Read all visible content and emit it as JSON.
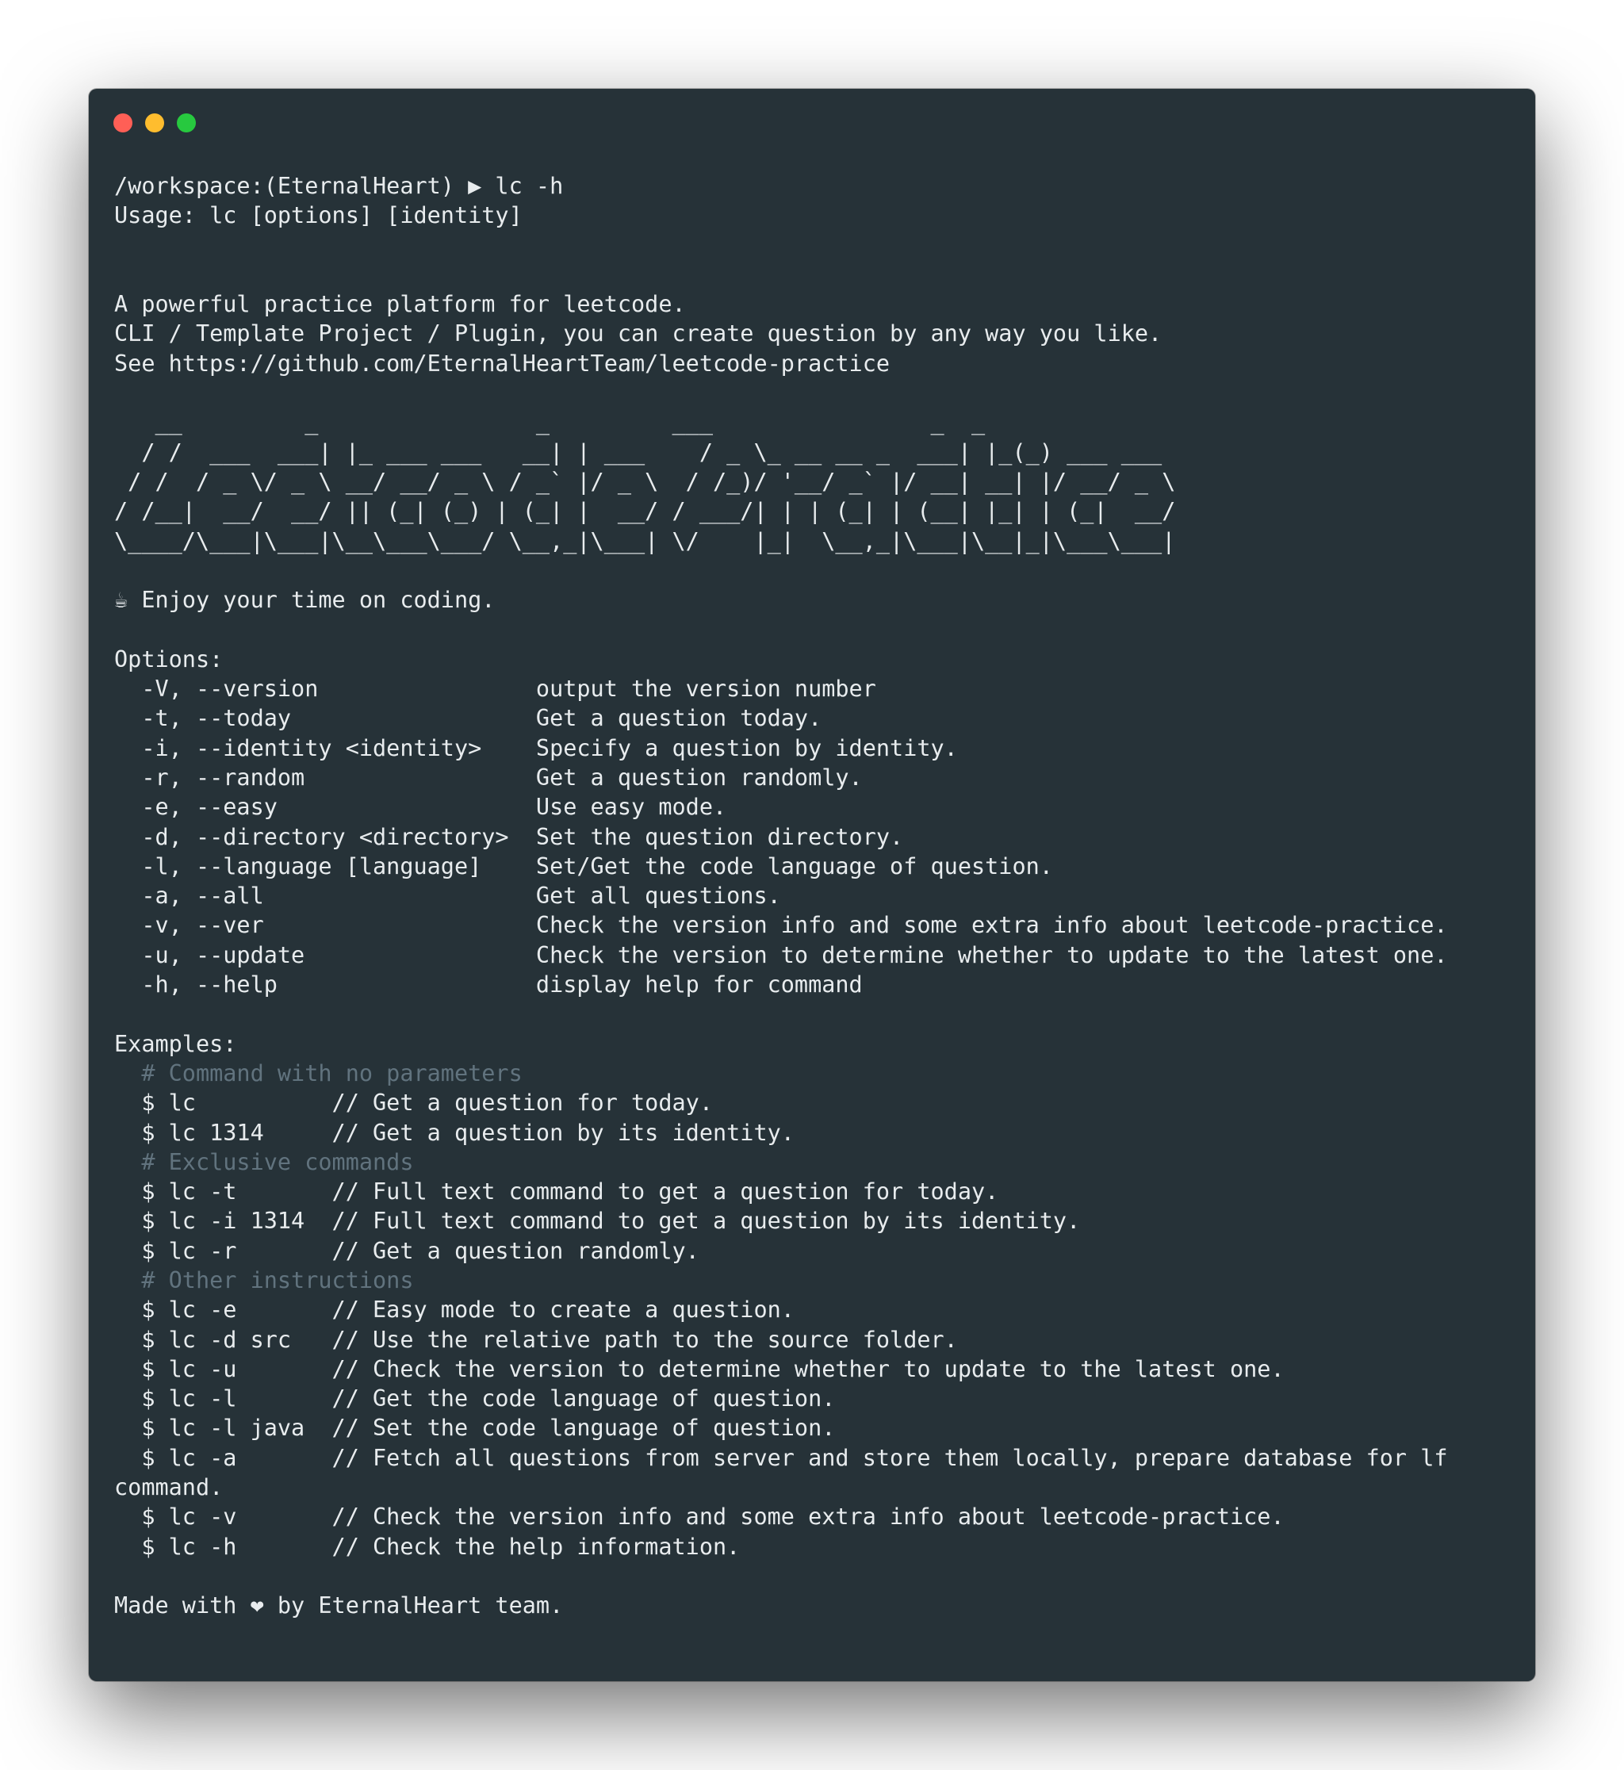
{
  "window": {
    "buttons": {
      "close_color": "#ff5f56",
      "minimize_color": "#ffbd2e",
      "maximize_color": "#27c93f"
    },
    "background_color": "#263238",
    "comment_color": "#61737e"
  },
  "terminal": {
    "lines": [
      {
        "text": "/workspace:(EternalHeart) ▶ lc -h",
        "kind": "prompt"
      },
      {
        "text": "Usage: lc [options] [identity]",
        "kind": "text"
      },
      {
        "text": "",
        "kind": "text"
      },
      {
        "text": "",
        "kind": "text"
      },
      {
        "text": "A powerful practice platform for leetcode.",
        "kind": "text"
      },
      {
        "text": "CLI / Template Project / Plugin, you can create question by any way you like.",
        "kind": "text"
      },
      {
        "text": "See https://github.com/EternalHeartTeam/leetcode-practice",
        "kind": "text"
      },
      {
        "text": "",
        "kind": "text"
      },
      {
        "text": "   __         _                _         ___                _  _",
        "kind": "text"
      },
      {
        "text": "  / /  ___  ___| |_ ___ ___   __| | ___    / _ \\_ __ __ _  ___| |_(_) ___ ___",
        "kind": "text"
      },
      {
        "text": " / /  / _ \\/ _ \\ __/ __/ _ \\ / _` |/ _ \\  / /_)/ '__/ _` |/ __| __| |/ __/ _ \\",
        "kind": "text"
      },
      {
        "text": "/ /__|  __/  __/ || (_| (_) | (_| |  __/ / ___/| | | (_| | (__| |_| | (_|  __/",
        "kind": "text"
      },
      {
        "text": "\\____/\\___|\\___|\\__\\___\\___/ \\__,_|\\___| \\/    |_|  \\__,_|\\___|\\__|_|\\___\\___|",
        "kind": "text"
      },
      {
        "text": "",
        "kind": "text"
      },
      {
        "text": "☕ Enjoy your time on coding.",
        "kind": "text"
      },
      {
        "text": "",
        "kind": "text"
      },
      {
        "text": "Options:",
        "kind": "text"
      },
      {
        "text": "  -V, --version                output the version number",
        "kind": "text"
      },
      {
        "text": "  -t, --today                  Get a question today.",
        "kind": "text"
      },
      {
        "text": "  -i, --identity <identity>    Specify a question by identity.",
        "kind": "text"
      },
      {
        "text": "  -r, --random                 Get a question randomly.",
        "kind": "text"
      },
      {
        "text": "  -e, --easy                   Use easy mode.",
        "kind": "text"
      },
      {
        "text": "  -d, --directory <directory>  Set the question directory.",
        "kind": "text"
      },
      {
        "text": "  -l, --language [language]    Set/Get the code language of question.",
        "kind": "text"
      },
      {
        "text": "  -a, --all                    Get all questions.",
        "kind": "text"
      },
      {
        "text": "  -v, --ver                    Check the version info and some extra info about leetcode-practice.",
        "kind": "text"
      },
      {
        "text": "  -u, --update                 Check the version to determine whether to update to the latest one.",
        "kind": "text"
      },
      {
        "text": "  -h, --help                   display help for command",
        "kind": "text"
      },
      {
        "text": "",
        "kind": "text"
      },
      {
        "text": "Examples:",
        "kind": "text"
      },
      {
        "text": "  # Command with no parameters",
        "kind": "comment"
      },
      {
        "text": "  $ lc          // Get a question for today.",
        "kind": "text"
      },
      {
        "text": "  $ lc 1314     // Get a question by its identity.",
        "kind": "text"
      },
      {
        "text": "  # Exclusive commands",
        "kind": "comment"
      },
      {
        "text": "  $ lc -t       // Full text command to get a question for today.",
        "kind": "text"
      },
      {
        "text": "  $ lc -i 1314  // Full text command to get a question by its identity.",
        "kind": "text"
      },
      {
        "text": "  $ lc -r       // Get a question randomly.",
        "kind": "text"
      },
      {
        "text": "  # Other instructions",
        "kind": "comment"
      },
      {
        "text": "  $ lc -e       // Easy mode to create a question.",
        "kind": "text"
      },
      {
        "text": "  $ lc -d src   // Use the relative path to the source folder.",
        "kind": "text"
      },
      {
        "text": "  $ lc -u       // Check the version to determine whether to update to the latest one.",
        "kind": "text"
      },
      {
        "text": "  $ lc -l       // Get the code language of question.",
        "kind": "text"
      },
      {
        "text": "  $ lc -l java  // Set the code language of question.",
        "kind": "text"
      },
      {
        "text": "  $ lc -a       // Fetch all questions from server and store them locally, prepare database for lf",
        "kind": "text"
      },
      {
        "text": "command.",
        "kind": "text"
      },
      {
        "text": "  $ lc -v       // Check the version info and some extra info about leetcode-practice.",
        "kind": "text"
      },
      {
        "text": "  $ lc -h       // Check the help information.",
        "kind": "text"
      },
      {
        "text": "",
        "kind": "text"
      },
      {
        "text": "Made with ❤ by EternalHeart team.",
        "kind": "text"
      }
    ]
  }
}
